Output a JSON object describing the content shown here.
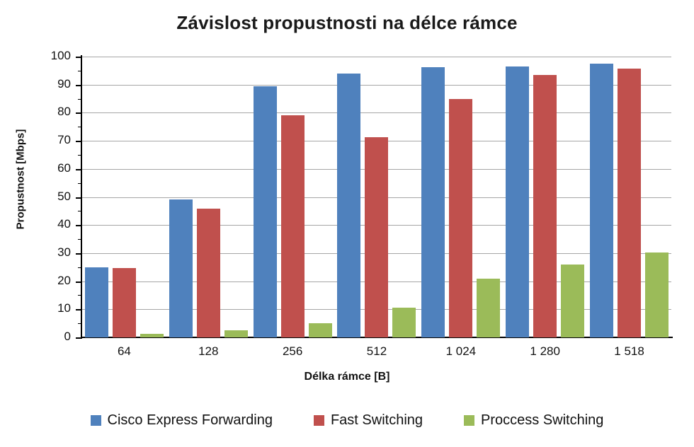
{
  "chart_data": {
    "type": "bar",
    "title": "Závislost propustnosti na délce rámce",
    "xlabel": "Délka rámce [B]",
    "ylabel": "Propustnost [Mbps]",
    "categories": [
      "64",
      "128",
      "256",
      "512",
      "1 024",
      "1 280",
      "1 518"
    ],
    "series": [
      {
        "name": "Cisco Express Forwarding",
        "color": "#4F81BD",
        "values": [
          25.0,
          49.0,
          89.3,
          94.0,
          96.3,
          96.5,
          97.6
        ]
      },
      {
        "name": "Fast Switching",
        "color": "#C0504D",
        "values": [
          24.7,
          45.8,
          79.0,
          71.3,
          85.0,
          93.4,
          95.6
        ]
      },
      {
        "name": "Proccess Switching",
        "color": "#9BBB59",
        "values": [
          1.3,
          2.5,
          5.0,
          10.5,
          20.8,
          26.0,
          30.2
        ]
      }
    ],
    "ylim": [
      0,
      100
    ],
    "ytick_step": 10,
    "yminor_step": 5,
    "yticks": [
      "0",
      "10",
      "20",
      "30",
      "40",
      "50",
      "60",
      "70",
      "80",
      "90",
      "100"
    ],
    "grid": true,
    "gridline_color": "#A6A6A6",
    "legend_position": "bottom",
    "plot_background": "#FFFFFF",
    "axis_color": "#000000"
  }
}
